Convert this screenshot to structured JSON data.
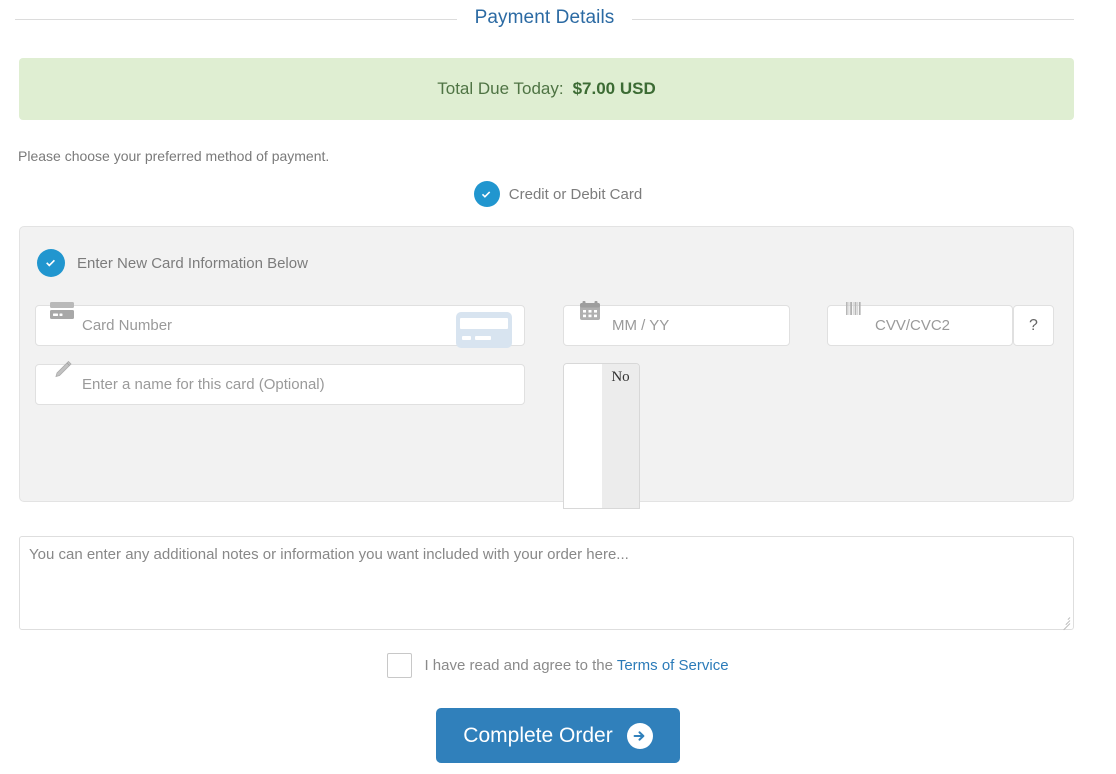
{
  "header": {
    "title": "Payment Details"
  },
  "total": {
    "label": "Total Due Today:",
    "amount": "$7.00 USD",
    "banner_color": "#dfeed2",
    "text_color": "#4f7444"
  },
  "method": {
    "instruction": "Please choose your preferred method of payment.",
    "selected_label": "Credit or Debit Card",
    "accent_color": "#2196cf"
  },
  "card_panel": {
    "heading": "Enter New Card Information Below",
    "fields": {
      "card_number_placeholder": "Card Number",
      "expiry_placeholder": "MM / YY",
      "cvv_placeholder": "CVV/CVC2",
      "card_name_placeholder": "Enter a name for this card (Optional)"
    },
    "help_button_label": "?",
    "clipped_widget_value": "No"
  },
  "notes": {
    "placeholder": "You can enter any additional notes or information you want included with your order here..."
  },
  "terms": {
    "text": "I have read and agree to the",
    "link_label": "Terms of Service",
    "link_color": "#2b7bb9",
    "checked": false
  },
  "submit": {
    "label": "Complete Order",
    "color": "#3080bb"
  },
  "icons": {
    "check": "check-icon",
    "credit_card": "credit-card-icon",
    "calendar": "calendar-icon",
    "barcode": "barcode-icon",
    "pencil": "pencil-icon",
    "arrow_right": "arrow-right-icon"
  }
}
